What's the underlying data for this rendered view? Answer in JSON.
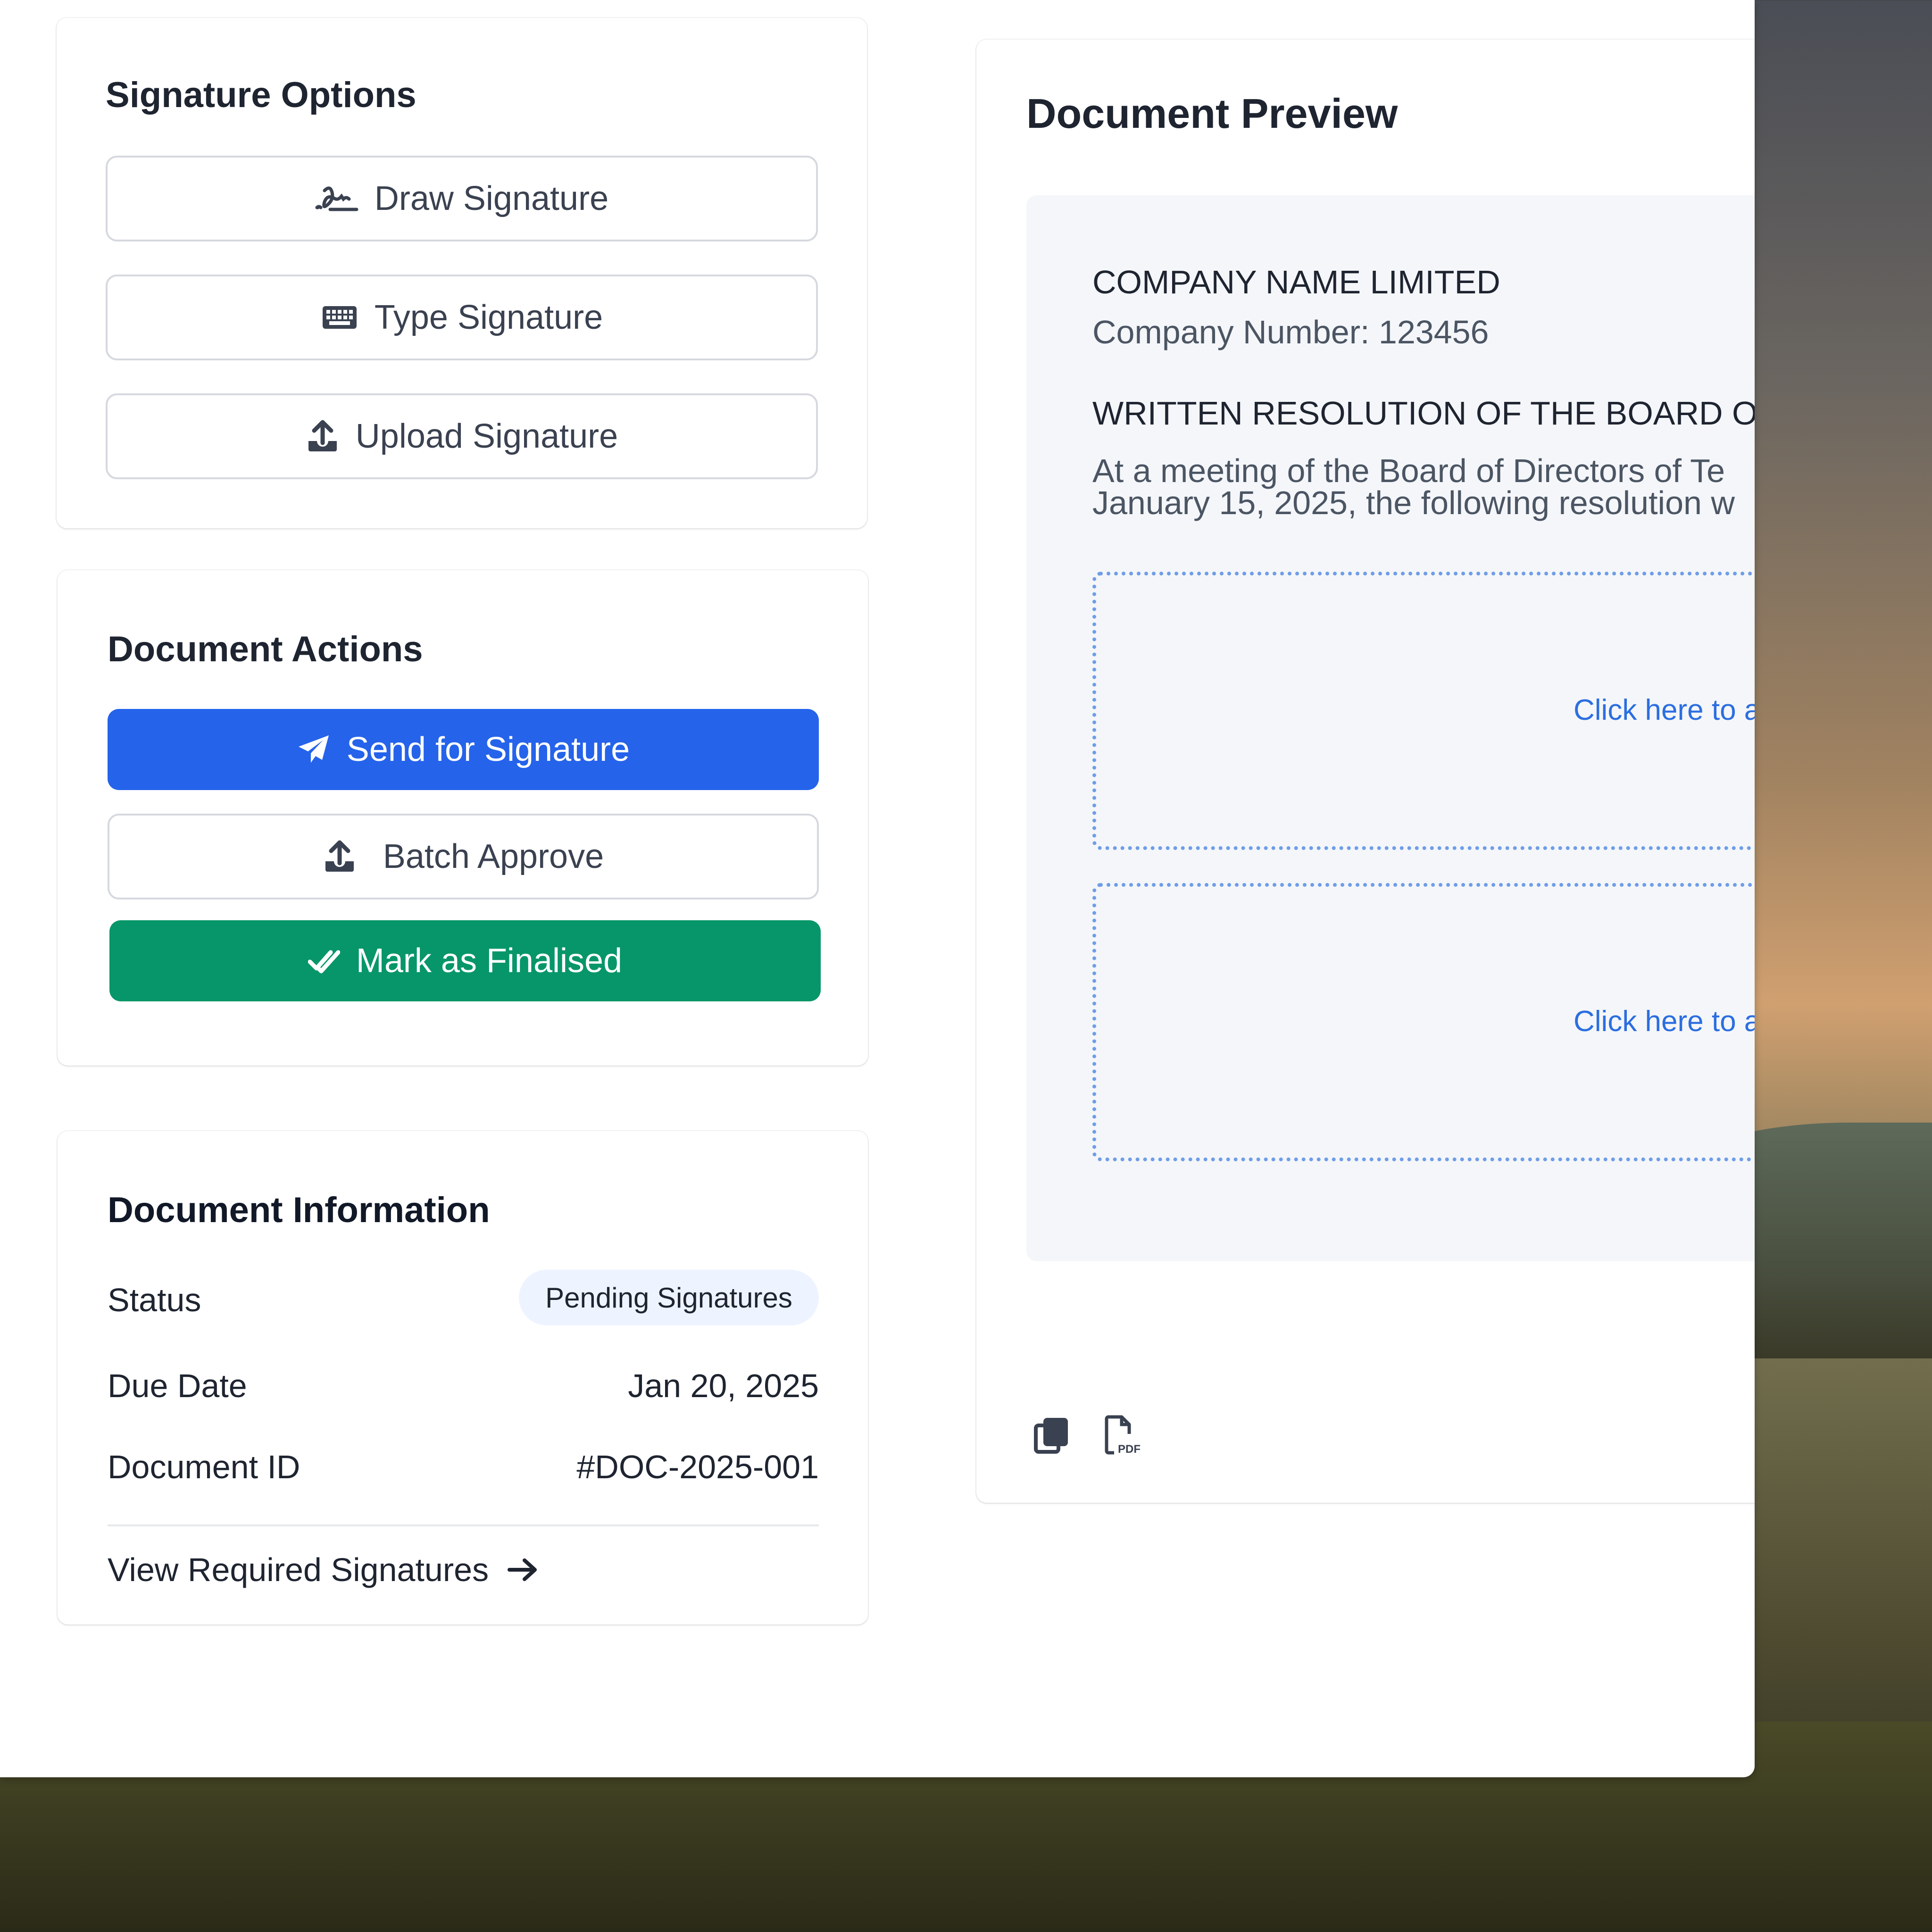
{
  "signature_options": {
    "title": "Signature Options",
    "draw_label": "Draw Signature",
    "type_label": "Type Signature",
    "upload_label": "Upload Signature"
  },
  "document_actions": {
    "title": "Document Actions",
    "send_label": "Send for Signature",
    "batch_label": "Batch Approve",
    "finalise_label": "Mark as Finalised"
  },
  "document_info": {
    "title": "Document Information",
    "status_label": "Status",
    "status_value": "Pending Signatures",
    "due_label": "Due Date",
    "due_value": "Jan 20, 2025",
    "id_label": "Document ID",
    "id_value": "#DOC-2025-001",
    "view_link": "View Required Signatures"
  },
  "preview": {
    "title": "Document Preview",
    "company_name": "COMPANY NAME LIMITED",
    "company_number": "Company Number: 123456",
    "resolution_heading": "WRITTEN RESOLUTION OF THE BOARD OF",
    "body_line1": "At a meeting of the Board of Directors of Te",
    "body_line2": "January 15, 2025, the following resolution w",
    "sig_prompt_1": "Click here to a",
    "sig_prompt_2": "Click here to a"
  },
  "colors": {
    "primary": "#2563eb",
    "success": "#079669",
    "link": "#2b6ee0"
  }
}
